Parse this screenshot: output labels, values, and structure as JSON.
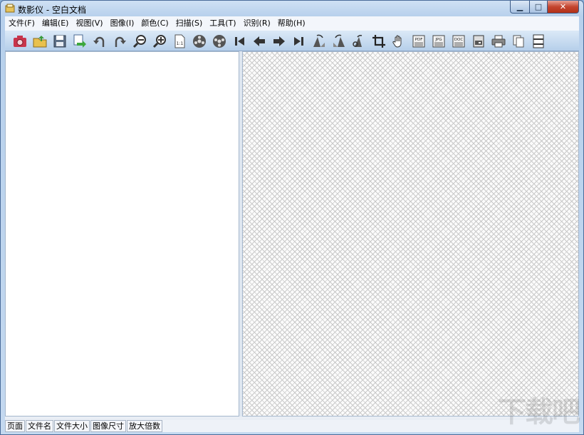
{
  "window": {
    "title": "数影仪 - 空白文档",
    "min_glyph": "▁",
    "max_glyph": "□",
    "close_glyph": "✕"
  },
  "menu": [
    {
      "label": "文件(F)"
    },
    {
      "label": "编辑(E)"
    },
    {
      "label": "视图(V)"
    },
    {
      "label": "图像(I)"
    },
    {
      "label": "颜色(C)"
    },
    {
      "label": "扫描(S)"
    },
    {
      "label": "工具(T)"
    },
    {
      "label": "识别(R)"
    },
    {
      "label": "帮助(H)"
    }
  ],
  "toolbar": [
    {
      "icon": "camera-icon"
    },
    {
      "icon": "open-folder-icon"
    },
    {
      "icon": "save-icon"
    },
    {
      "icon": "export-icon"
    },
    {
      "icon": "rotate-left-icon"
    },
    {
      "icon": "rotate-right-icon"
    },
    {
      "icon": "zoom-out-icon"
    },
    {
      "icon": "zoom-in-icon"
    },
    {
      "icon": "actual-size-icon",
      "text": "1:1"
    },
    {
      "icon": "film-reel-left-icon"
    },
    {
      "icon": "film-reel-right-icon"
    },
    {
      "icon": "first-page-icon"
    },
    {
      "icon": "previous-icon"
    },
    {
      "icon": "next-icon"
    },
    {
      "icon": "last-page-icon"
    },
    {
      "icon": "deskew-left-icon"
    },
    {
      "icon": "deskew-right-icon"
    },
    {
      "icon": "deskew-auto-icon"
    },
    {
      "icon": "crop-icon"
    },
    {
      "icon": "hand-pan-icon"
    },
    {
      "icon": "pdf-icon",
      "text": "PDF"
    },
    {
      "icon": "jpg-icon",
      "text": "JPG"
    },
    {
      "icon": "doc-icon",
      "text": "DOC"
    },
    {
      "icon": "scanner-icon"
    },
    {
      "icon": "printer-icon"
    },
    {
      "icon": "copy-icon"
    },
    {
      "icon": "page-layout-icon"
    }
  ],
  "status": {
    "page": "页面",
    "filename": "文件名",
    "filesize": "文件大小",
    "image_size": "图像尺寸",
    "zoom": "放大倍数"
  },
  "watermark": "下载吧"
}
